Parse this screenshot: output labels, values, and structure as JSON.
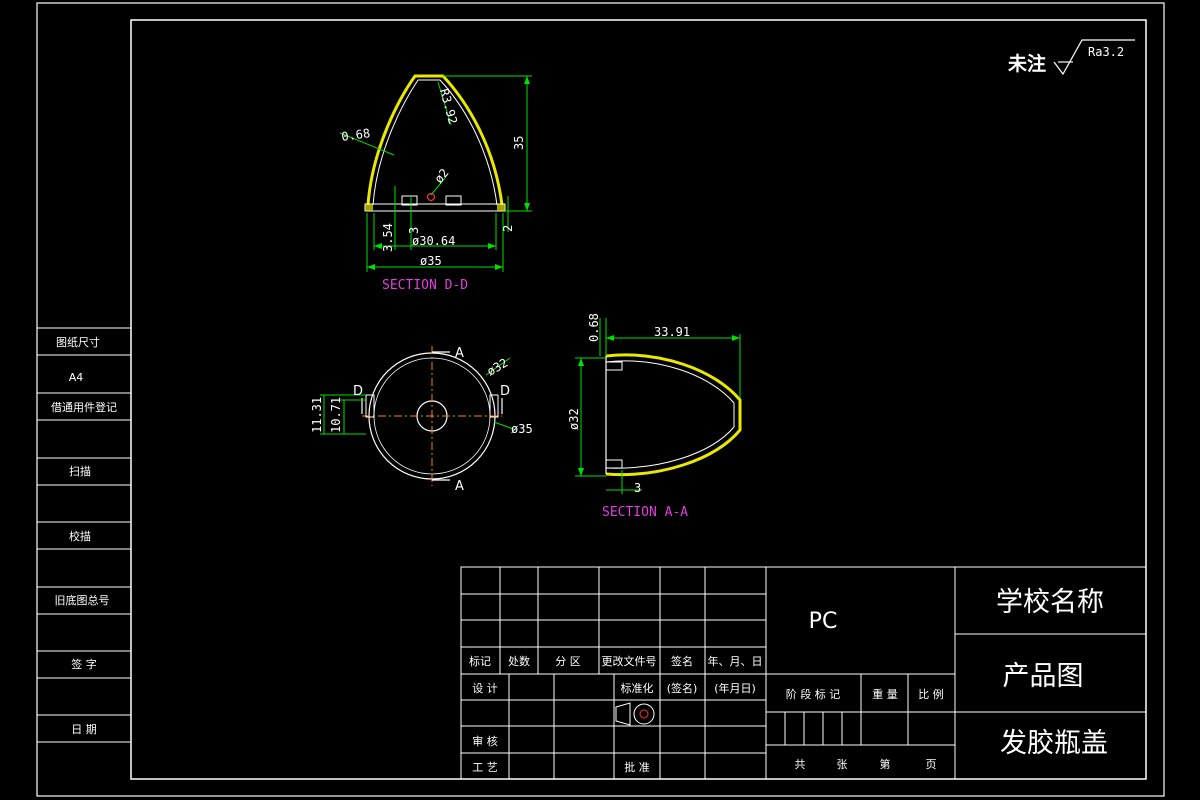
{
  "roughness": {
    "prefix": "未注",
    "value": "Ra3.2"
  },
  "left_column": {
    "paper_size_label": "图纸尺寸",
    "paper_size_value": "A4",
    "borrow_register": "借通用件登记",
    "scan": "扫描",
    "proof": "校描",
    "old_drawing_no": "旧底图总号",
    "signature": "签 字",
    "date": "日 期"
  },
  "section_dd": {
    "title": "SECTION D-D",
    "dims": {
      "wall": "0.68",
      "radius": "R3.92",
      "height": "35",
      "hole": "ø2",
      "d354": "3.54",
      "d3": "3",
      "d3064": "ø30.64",
      "d35": "ø35",
      "d2": "2"
    }
  },
  "top_view": {
    "cut_a": "A",
    "cut_d": "D",
    "dims": {
      "d32": "ø32",
      "d35": "ø35",
      "d1131": "11.31",
      "d1071": "10.71"
    }
  },
  "section_aa": {
    "title": "SECTION A-A",
    "dims": {
      "d068": "0.68",
      "d3391": "33.91",
      "d32": "ø32",
      "d3": "3"
    }
  },
  "title_block": {
    "material": "PC",
    "school": "学校名称",
    "drawing_type": "产品图",
    "part_name": "发胶瓶盖",
    "rev_headers": [
      "标记",
      "处数",
      "分 区",
      "更改文件号",
      "签名",
      "年、月、日"
    ],
    "design": "设 计",
    "standardize": "标准化",
    "sign_paren": "(签名)",
    "date_paren": "(年月日)",
    "review": "审 核",
    "process": "工 艺",
    "approve": "批 准",
    "stage_mark": "阶 段 标 记",
    "weight": "重 量",
    "scale": "比 例",
    "total": "共",
    "sheets": "张",
    "nth": "第",
    "page": "页"
  }
}
